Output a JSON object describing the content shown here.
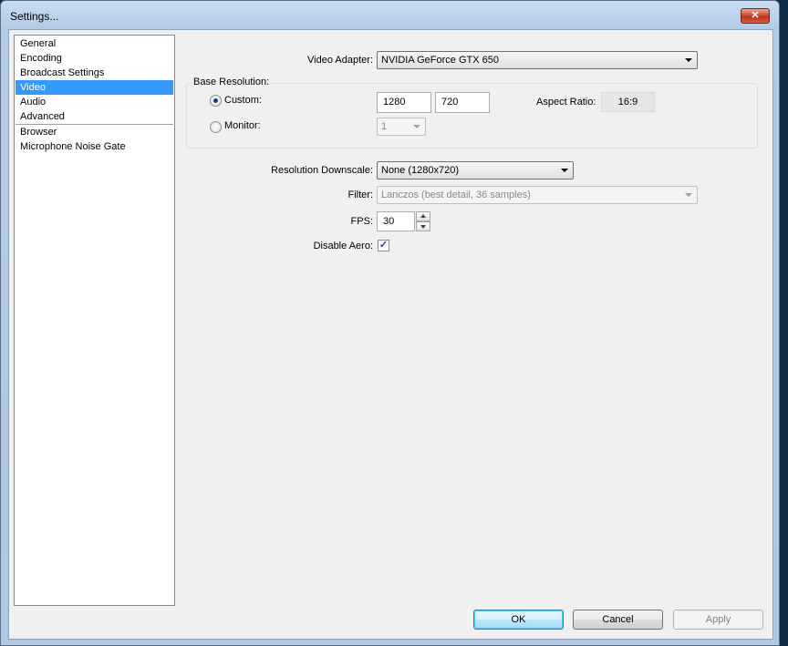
{
  "window": {
    "title": "Settings...",
    "close_label": "✕"
  },
  "sidebar": {
    "items": [
      {
        "label": "General"
      },
      {
        "label": "Encoding"
      },
      {
        "label": "Broadcast Settings"
      },
      {
        "label": "Video",
        "selected": true
      },
      {
        "label": "Audio"
      },
      {
        "label": "Advanced"
      },
      {
        "label": "Browser"
      },
      {
        "label": "Microphone Noise Gate"
      }
    ]
  },
  "video": {
    "adapter_label": "Video Adapter:",
    "adapter_value": "NVIDIA GeForce GTX 650",
    "base_resolution": {
      "group_label": "Base Resolution:",
      "custom_label": "Custom:",
      "custom_selected": true,
      "width": "1280",
      "height": "720",
      "aspect_label": "Aspect Ratio:",
      "aspect_value": "16:9",
      "monitor_label": "Monitor:",
      "monitor_value": "1"
    },
    "downscale_label": "Resolution Downscale:",
    "downscale_value": "None  (1280x720)",
    "filter_label": "Filter:",
    "filter_value": "Lanczos (best detail, 36 samples)",
    "fps_label": "FPS:",
    "fps_value": "30",
    "disable_aero_label": "Disable Aero:",
    "disable_aero_checked": true,
    "check_glyph": "✓"
  },
  "buttons": {
    "ok": "OK",
    "cancel": "Cancel",
    "apply": "Apply"
  },
  "colors": {
    "selection": "#3399ff",
    "titlebar": "#b3cbe6",
    "close": "#c8452c"
  }
}
